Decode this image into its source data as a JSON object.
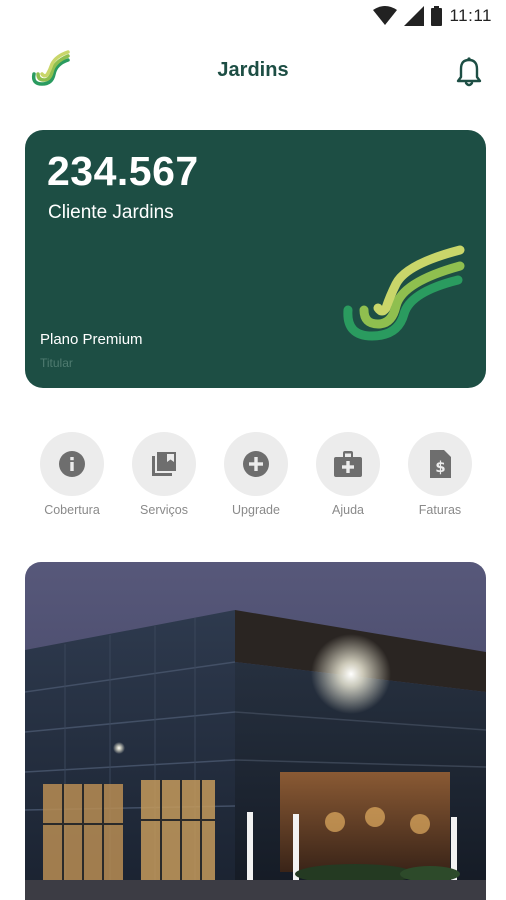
{
  "status_bar": {
    "time": "11:11",
    "icons": [
      "wifi-icon",
      "signal-icon",
      "battery-icon"
    ]
  },
  "header": {
    "title": "Jardins",
    "logo": "brand-logo",
    "notification_icon": "bell-icon"
  },
  "card": {
    "number": "234.567",
    "name": "Cliente Jardins",
    "plan": "Plano Premium",
    "role": "Titular",
    "background_color": "#1d4e44"
  },
  "actions": [
    {
      "label": "Cobertura",
      "icon": "info-icon"
    },
    {
      "label": "Serviços",
      "icon": "library-icon"
    },
    {
      "label": "Upgrade",
      "icon": "add-circle-icon"
    },
    {
      "label": "Ajuda",
      "icon": "medical-kit-icon"
    },
    {
      "label": "Faturas",
      "icon": "invoice-icon"
    }
  ],
  "banner": {
    "image": "building-photo-night"
  },
  "colors": {
    "brand_dark": "#1d4e44",
    "brand_light": "#c9d66a",
    "brand_mid": "#8fbf4f",
    "brand_green": "#2a9b5f"
  }
}
